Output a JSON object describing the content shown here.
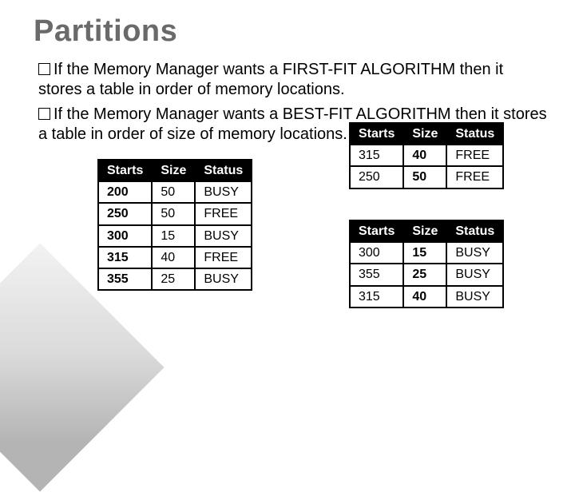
{
  "title": "Partitions",
  "bullets": {
    "b1_prefix": "If",
    "b1_rest": " the Memory Manager wants a FIRST-FIT ALGORITHM then it stores a table in order of memory locations.",
    "b2_prefix": "If",
    "b2_rest": " the Memory Manager wants a BEST-FIT ALGORITHM then it stores a table in order of size of memory locations."
  },
  "headers": {
    "starts": "Starts",
    "size": "Size",
    "status": "Status"
  },
  "table_left": [
    {
      "starts": "200",
      "size": "50",
      "status": "BUSY"
    },
    {
      "starts": "250",
      "size": "50",
      "status": "FREE"
    },
    {
      "starts": "300",
      "size": "15",
      "status": "BUSY"
    },
    {
      "starts": "315",
      "size": "40",
      "status": "FREE"
    },
    {
      "starts": "355",
      "size": "25",
      "status": "BUSY"
    }
  ],
  "table_right1": [
    {
      "starts": "315",
      "size": "40",
      "status": "FREE"
    },
    {
      "starts": "250",
      "size": "50",
      "status": "FREE"
    }
  ],
  "table_right2": [
    {
      "starts": "300",
      "size": "15",
      "status": "BUSY"
    },
    {
      "starts": "355",
      "size": "25",
      "status": "BUSY"
    },
    {
      "starts": "315",
      "size": "40",
      "status": "BUSY"
    }
  ]
}
